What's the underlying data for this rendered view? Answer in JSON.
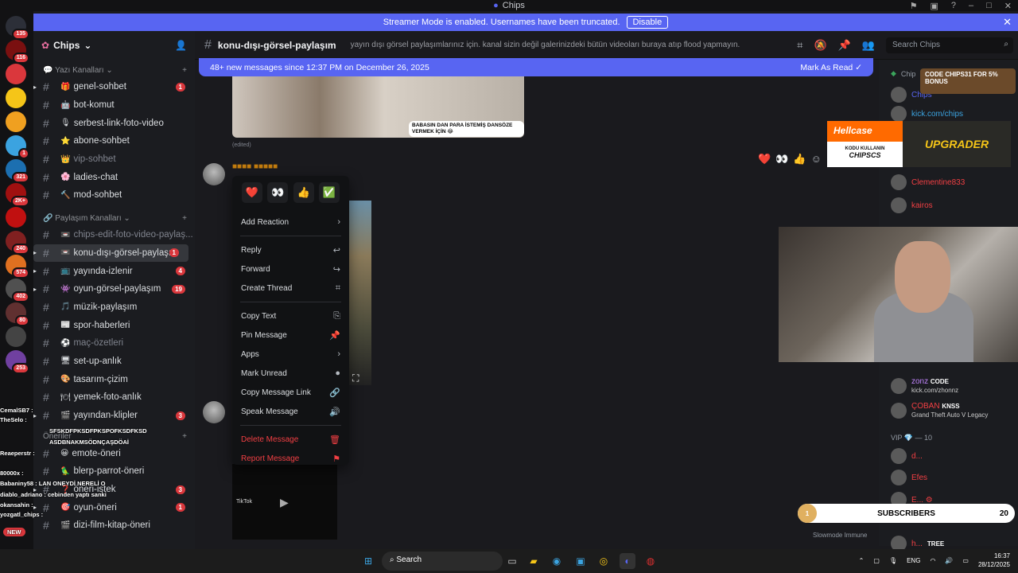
{
  "window": {
    "title": "Chips"
  },
  "banner": {
    "text": "Streamer Mode is enabled. Usernames have been truncated.",
    "button": "Disable"
  },
  "servers": [
    {
      "badge": "135",
      "color": "#2c2f38"
    },
    {
      "badge": "116",
      "color": "#7a1010"
    },
    {
      "badge": "",
      "color": "#da373c"
    },
    {
      "badge": "",
      "color": "#f5c518"
    },
    {
      "badge": "",
      "color": "#f0a020"
    },
    {
      "badge": "1",
      "color": "#3ba3e0"
    },
    {
      "badge": "321",
      "color": "#1c6fb0"
    },
    {
      "badge": "2K+",
      "color": "#a01010"
    },
    {
      "badge": "",
      "color": "#c01010"
    },
    {
      "badge": "240",
      "color": "#802020"
    },
    {
      "badge": "574",
      "color": "#e07020"
    },
    {
      "badge": "402",
      "color": "#505050"
    },
    {
      "badge": "80",
      "color": "#603030"
    },
    {
      "badge": "",
      "color": "#444"
    },
    {
      "badge": "253",
      "color": "#7040a0"
    }
  ],
  "guild": {
    "name": "Chips"
  },
  "categories": {
    "text": "Yazı Kanalları",
    "share": "Paylaşım Kanalları",
    "suggest": "Öneriler"
  },
  "channels_text": [
    {
      "name": "genel-sohbet",
      "emoji": "🎁",
      "badge": "1",
      "muted": false
    },
    {
      "name": "bot-komut",
      "emoji": "🤖",
      "badge": "",
      "muted": false
    },
    {
      "name": "serbest-link-foto-video",
      "emoji": "🎙",
      "badge": "",
      "muted": false
    },
    {
      "name": "abone-sohbet",
      "emoji": "⭐",
      "badge": "",
      "muted": false
    },
    {
      "name": "vip-sohbet",
      "emoji": "👑",
      "badge": "",
      "muted": true
    },
    {
      "name": "ladies-chat",
      "emoji": "🌸",
      "badge": "",
      "muted": false
    },
    {
      "name": "mod-sohbet",
      "emoji": "🔨",
      "badge": "",
      "muted": false
    }
  ],
  "channels_share": [
    {
      "name": "chips-edit-foto-video-paylaş...",
      "emoji": "📼",
      "badge": "",
      "muted": true,
      "active": false
    },
    {
      "name": "konu-dışı-görsel-paylaşım",
      "emoji": "📼",
      "badge": "1",
      "muted": false,
      "active": true
    },
    {
      "name": "yayında-izlenir",
      "emoji": "📺",
      "badge": "4",
      "muted": false,
      "active": false
    },
    {
      "name": "oyun-görsel-paylaşım",
      "emoji": "👾",
      "badge": "19",
      "muted": false,
      "active": false
    },
    {
      "name": "müzik-paylaşım",
      "emoji": "🎵",
      "badge": "",
      "muted": false,
      "active": false
    },
    {
      "name": "spor-haberleri",
      "emoji": "📰",
      "badge": "",
      "muted": false,
      "active": false
    },
    {
      "name": "maç-özetleri",
      "emoji": "⚽",
      "badge": "",
      "muted": true,
      "active": false
    },
    {
      "name": "set-up-anlık",
      "emoji": "🖥",
      "badge": "",
      "muted": false,
      "active": false
    },
    {
      "name": "tasarım-çizim",
      "emoji": "🎨",
      "badge": "",
      "muted": false,
      "active": false
    },
    {
      "name": "yemek-foto-anlık",
      "emoji": "🍽",
      "badge": "",
      "muted": false,
      "active": false
    },
    {
      "name": "yayından-klipler",
      "emoji": "🎬",
      "badge": "3",
      "muted": false,
      "active": false
    }
  ],
  "channels_suggest": [
    {
      "name": "emote-öneri",
      "emoji": "😀",
      "badge": ""
    },
    {
      "name": "blerp-parrot-öneri",
      "emoji": "🦜",
      "badge": ""
    },
    {
      "name": "öneri-istek",
      "emoji": "❓",
      "badge": "3"
    },
    {
      "name": "oyun-öneri",
      "emoji": "🎯",
      "badge": "1"
    },
    {
      "name": "dizi-film-kitap-öneri",
      "emoji": "🎬",
      "badge": ""
    }
  ],
  "topbar": {
    "channel": "konu-dışı-görsel-paylaşım",
    "topic": "yayın dışı görsel paylaşımlarınız için. kanal sizin değil galerinizdeki bütün videoları buraya atıp flood yapmayın.",
    "search": "Search Chips"
  },
  "newbar": {
    "text": "48+ new messages since 12:37 PM on December 26, 2025",
    "action": "Mark As Read"
  },
  "messages": {
    "caption": "BABASIN DAN PARA İSTEMİŞ DANSÖZE VERMEK İÇİN 😂",
    "edited": "(edited)",
    "tiktok": "TikTok"
  },
  "menu": {
    "emojis": [
      "❤️",
      "👀",
      "👍",
      "✅"
    ],
    "groups": [
      [
        {
          "label": "Add Reaction",
          "icon": "›",
          "danger": false
        }
      ],
      [
        {
          "label": "Reply",
          "icon": "↩",
          "danger": false
        },
        {
          "label": "Forward",
          "icon": "↪",
          "danger": false
        },
        {
          "label": "Create Thread",
          "icon": "⌗",
          "danger": false
        }
      ],
      [
        {
          "label": "Copy Text",
          "icon": "⎘",
          "danger": false
        },
        {
          "label": "Pin Message",
          "icon": "📌",
          "danger": false
        },
        {
          "label": "Apps",
          "icon": "›",
          "danger": false
        },
        {
          "label": "Mark Unread",
          "icon": "●",
          "danger": false
        },
        {
          "label": "Copy Message Link",
          "icon": "🔗",
          "danger": false
        },
        {
          "label": "Speak Message",
          "icon": "🔊",
          "danger": false
        }
      ],
      [
        {
          "label": "Delete Message",
          "icon": "🗑",
          "danger": true
        },
        {
          "label": "Report Message",
          "icon": "⚑",
          "danger": true
        }
      ]
    ]
  },
  "members": {
    "header": "Chip",
    "names": [
      "Chips",
      "kick.com/chips",
      "Clementine833",
      "kairos",
      "zonz",
      "kick.com/zhonnz",
      "ÇOBAN",
      "Grand Theft Auto V Legacy",
      "d...",
      "Efes",
      "E... ⚙",
      "h...",
      "TREE"
    ],
    "vip": "VIP 💎 — 10",
    "badges": [
      "CODE",
      "KNSS"
    ]
  },
  "overlays": {
    "chipsbox": "CODE CHIPS31 FOR 5% BONUS",
    "hellcase": "Hellcase",
    "hellcase_sub": "KODU KULLANIN",
    "hellcase_code": "CHIPSCS",
    "upgrader": "UPGRADER",
    "subs": "SUBSCRIBERS",
    "subs_left": "1",
    "subs_count": "20",
    "slowmode": "Slowmode Immune"
  },
  "chat_overlay": [
    "CemalSB7 :",
    "TheSelo :",
    "SFSKDFPKSDFPKSPOFKSDFKSD",
    "ASDBNAKMSÖDNÇAŞDÖAİ",
    "Reaeperstr :",
    "80000x :",
    "Babaniny58 : LAN ONEYDİ NERELİ O",
    "diablo_adriano : cebinden yaptı sanki",
    "okansahin :",
    "yozgatl_chips :",
    "NEW"
  ],
  "taskbar": {
    "search": "Search",
    "lang": "ENG",
    "time": "16:37",
    "date": "28/12/2025"
  }
}
